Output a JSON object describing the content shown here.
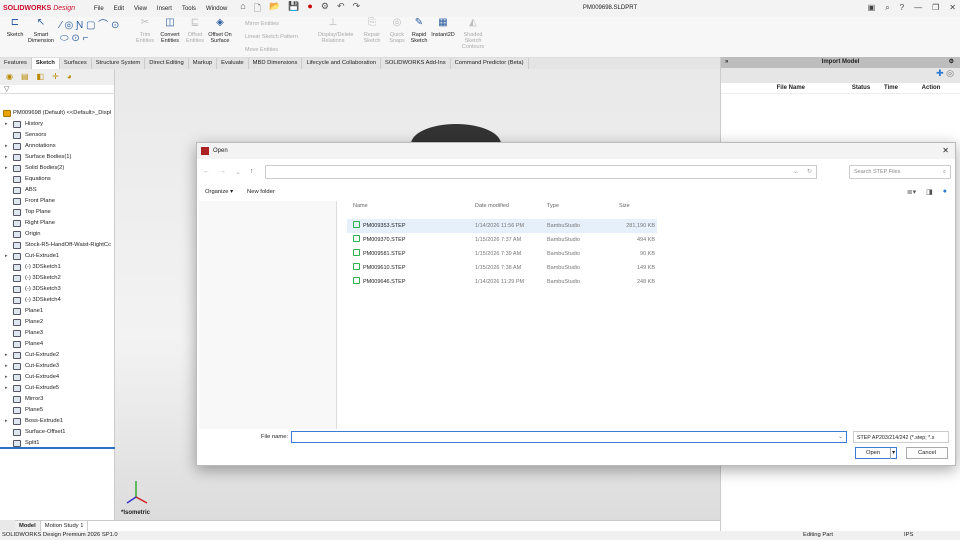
{
  "app": {
    "brand": "SOLIDWORKS",
    "brand_suffix": "Design",
    "document_title": "PM009698.SLDPRT",
    "menu": [
      "File",
      "Edit",
      "View",
      "Insert",
      "Tools",
      "Window"
    ]
  },
  "ribbon": {
    "buttons": [
      {
        "label": "Sketch",
        "enabled": true
      },
      {
        "label": "Smart Dimension",
        "enabled": true
      },
      {
        "label": "Trim Entities",
        "enabled": false
      },
      {
        "label": "Convert Entities",
        "enabled": true
      },
      {
        "label": "Offset Entities",
        "enabled": false
      },
      {
        "label": "Offset On Surface",
        "enabled": true
      },
      {
        "label": "Display/Delete Relations",
        "enabled": false
      },
      {
        "label": "Repair Sketch",
        "enabled": false
      },
      {
        "label": "Quick Snaps",
        "enabled": false
      },
      {
        "label": "Rapid Sketch",
        "enabled": true
      },
      {
        "label": "Instant2D",
        "enabled": true
      },
      {
        "label": "Shaded Sketch Contours",
        "enabled": false
      }
    ],
    "small": [
      "Mirror Entities",
      "Linear Sketch Pattern",
      "Move Entities"
    ]
  },
  "tabs": [
    "Features",
    "Sketch",
    "Surfaces",
    "Structure System",
    "Direct Editing",
    "Markup",
    "Evaluate",
    "MBD Dimensions",
    "Lifecycle and Collaboration",
    "SOLIDWORKS Add-Ins",
    "Command Predictor (Beta)"
  ],
  "active_tab": "Sketch",
  "tree": {
    "root": "PM009698 (Default) <<Default>_Displ",
    "items": [
      {
        "label": "History",
        "expand": true
      },
      {
        "label": "Sensors"
      },
      {
        "label": "Annotations",
        "expand": true
      },
      {
        "label": "Surface Bodies(1)",
        "expand": true
      },
      {
        "label": "Solid Bodies(2)",
        "expand": true
      },
      {
        "label": "Equations"
      },
      {
        "label": "ABS"
      },
      {
        "label": "Front Plane"
      },
      {
        "label": "Top Plane"
      },
      {
        "label": "Right Plane"
      },
      {
        "label": "Origin"
      },
      {
        "label": "Stock-R5-HandOff-Waist-RightCc"
      },
      {
        "label": "Cut-Extrude1",
        "expand": true
      },
      {
        "label": "(-) 3DSketch1"
      },
      {
        "label": "(-) 3DSketch2"
      },
      {
        "label": "(-) 3DSketch3"
      },
      {
        "label": "(-) 3DSketch4"
      },
      {
        "label": "Plane1"
      },
      {
        "label": "Plane2"
      },
      {
        "label": "Plane3"
      },
      {
        "label": "Plane4"
      },
      {
        "label": "Cut-Extrude2",
        "expand": true
      },
      {
        "label": "Cut-Extrude3",
        "expand": true
      },
      {
        "label": "Cut-Extrude4",
        "expand": true
      },
      {
        "label": "Cut-Extrude5",
        "expand": true
      },
      {
        "label": "Mirror3"
      },
      {
        "label": "Plane5"
      },
      {
        "label": "Boss-Extrude1",
        "expand": true
      },
      {
        "label": "Surface-Offset1"
      },
      {
        "label": "Split1"
      }
    ]
  },
  "viewport": {
    "view_label": "*Isometric"
  },
  "bottom_tabs": [
    "Model",
    "Motion Study 1"
  ],
  "status": {
    "product": "SOLIDWORKS Design Premium 2026 SP1.0",
    "mode": "Editing Part",
    "units": "IPS"
  },
  "import_panel": {
    "title": "Import Model",
    "columns": [
      "File Name",
      "Status",
      "Time",
      "Action"
    ]
  },
  "dialog": {
    "title": "Open",
    "search_placeholder": "Search STEP Files",
    "organize": "Organize ▾",
    "new_folder": "New folder",
    "columns": [
      "Name",
      "Date modified",
      "Type",
      "Size"
    ],
    "files": [
      {
        "name": "PM009353.STEP",
        "date": "1/14/2026 11:56 PM",
        "type": "BambuStudio",
        "size": "281,190 KB",
        "selected": true
      },
      {
        "name": "PM009370.STEP",
        "date": "1/15/2026 7:37 AM",
        "type": "BambuStudio",
        "size": "494 KB"
      },
      {
        "name": "PM009581.STEP",
        "date": "1/15/2026 7:39 AM",
        "type": "BambuStudio",
        "size": "90 KB"
      },
      {
        "name": "PM009610.STEP",
        "date": "1/15/2026 7:38 AM",
        "type": "BambuStudio",
        "size": "149 KB"
      },
      {
        "name": "PM009646.STEP",
        "date": "1/14/2026 11:29 PM",
        "type": "BambuStudio",
        "size": "248 KB"
      }
    ],
    "file_name_label": "File name:",
    "file_name_value": "",
    "file_type": "STEP AP203/214/242 (*.step; *.s",
    "open": "Open",
    "cancel": "Cancel"
  },
  "colors": {
    "brand": "#c8102e",
    "accent": "#2a72c4",
    "step_icon": "#2bb24c"
  }
}
